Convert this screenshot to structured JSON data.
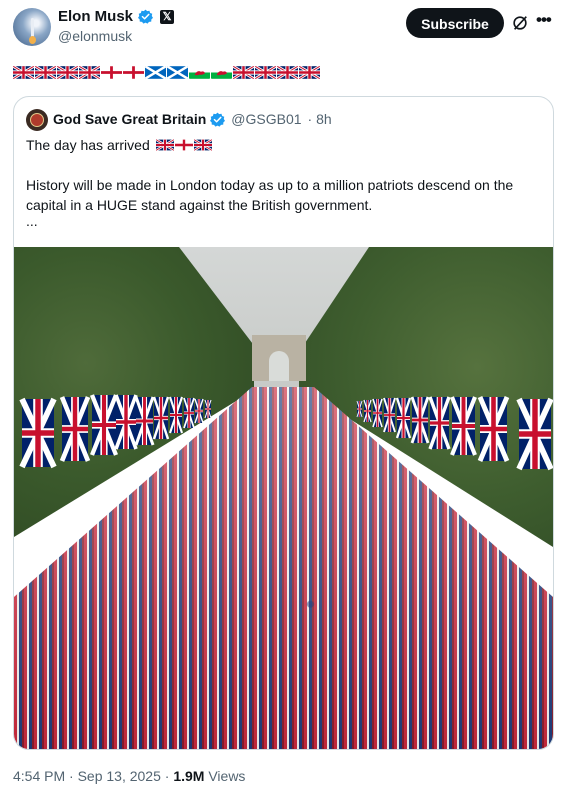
{
  "author": {
    "name": "Elon Musk",
    "handle": "@elonmusk"
  },
  "subscribe_label": "Subscribe",
  "post_flags": [
    "uk",
    "uk",
    "uk",
    "uk",
    "england",
    "england",
    "scotland",
    "scotland",
    "wales",
    "wales",
    "uk",
    "uk",
    "uk",
    "uk"
  ],
  "quoted": {
    "name": "God Save Great Britain",
    "handle": "@GSGB01",
    "time": "· 8h",
    "line1": "The day has arrived",
    "line1_flags": [
      "uk",
      "england",
      "uk"
    ],
    "line2": "History will be made in London today as up to a million patriots descend on the capital in a HUGE stand against the British government.",
    "ellipsis": "..."
  },
  "meta": {
    "time_date": "4:54 PM · Sep 13, 2025 · ",
    "views_count": "1.9M",
    "views_label": " Views"
  },
  "colors": {
    "verified": "#1d9bf0",
    "flag_red": "#c8102e",
    "flag_blue": "#012169",
    "text_secondary": "#536471"
  }
}
